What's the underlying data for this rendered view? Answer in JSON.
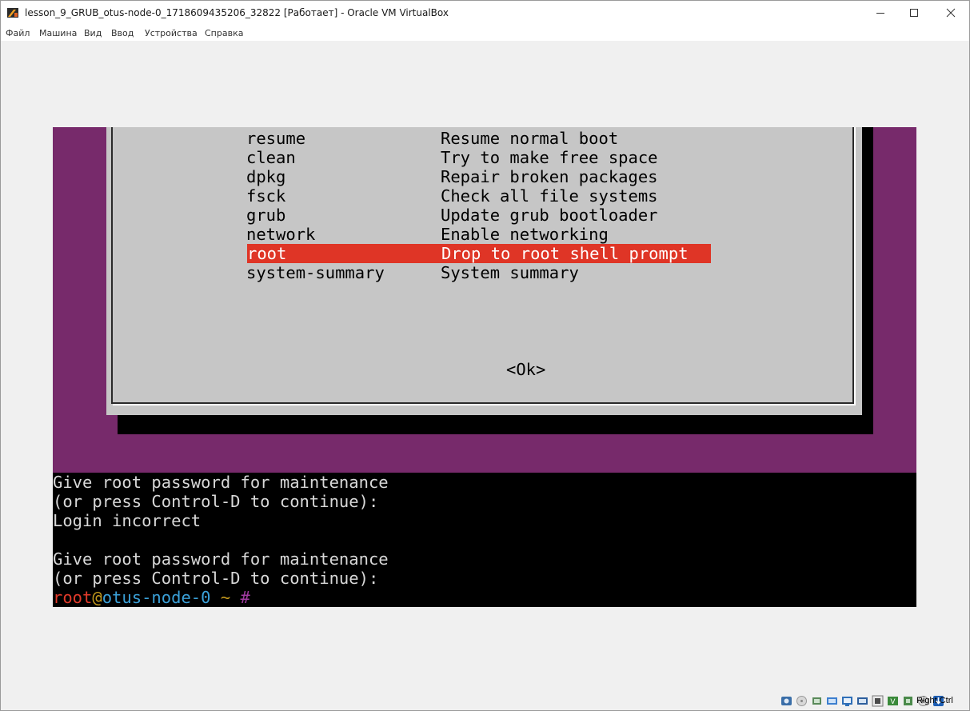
{
  "window": {
    "title": "lesson_9_GRUB_otus-node-0_1718609435206_32822 [Работает] - Oracle VM VirtualBox"
  },
  "menubar": {
    "items": [
      "Файл",
      "Машина",
      "Вид",
      "Ввод",
      "Устройства",
      "Справка"
    ]
  },
  "recovery_menu": {
    "items": [
      {
        "key": "resume",
        "desc": "Resume normal boot"
      },
      {
        "key": "clean",
        "desc": "Try to make free space"
      },
      {
        "key": "dpkg",
        "desc": "Repair broken packages"
      },
      {
        "key": "fsck",
        "desc": "Check all file systems"
      },
      {
        "key": "grub",
        "desc": "Update grub bootloader"
      },
      {
        "key": "network",
        "desc": "Enable networking"
      },
      {
        "key": "root",
        "desc": "Drop to root shell prompt"
      },
      {
        "key": "system-summary",
        "desc": "System summary"
      }
    ],
    "selected": "root",
    "ok_label": "<Ok>"
  },
  "console": {
    "lines": [
      "Give root password for maintenance",
      "(or press Control-D to continue):",
      "Login incorrect",
      "",
      "Give root password for maintenance",
      "(or press Control-D to continue):"
    ],
    "prompt": {
      "user": "root",
      "at": "@",
      "host": "otus-node-0",
      "path": " ~ ",
      "symbol": "#"
    }
  },
  "statusbar": {
    "host_key": "Right Ctrl",
    "icons": [
      "hard-disk-icon",
      "optical-drive-icon",
      "audio-icon",
      "network-icon",
      "usb-icon",
      "shared-folders-icon",
      "display-icon",
      "video-capture-icon",
      "cpu-icon",
      "mouse-integration-icon",
      "keyboard-icon"
    ]
  },
  "colors": {
    "purple": "#772a6b",
    "dialog": "#c6c6c6",
    "highlight": "#df3526",
    "console_text": "#d8d8d8"
  }
}
